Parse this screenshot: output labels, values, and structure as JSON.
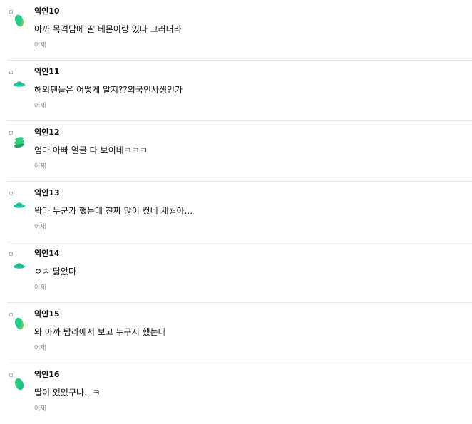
{
  "comments": [
    {
      "author": "익인10",
      "text": "아까 목격담에 딸 베몬이랑 있다 그러더라",
      "time": "어제",
      "avatar": "green-yellow-leaf-icon"
    },
    {
      "author": "익인11",
      "text": "해외팬들은 어떻게 알지??외국인사생인가",
      "time": "어제",
      "avatar": "mint-flat-icon"
    },
    {
      "author": "익인12",
      "text": "엄마 아빠 얼굴 다 보이네ㅋㅋㅋ",
      "time": "어제",
      "avatar": "green-stacked-icon"
    },
    {
      "author": "익인13",
      "text": "왐마 누군가 했는데 진짜 많이 컸네 세월아...",
      "time": "어제",
      "avatar": "mint-flat-icon"
    },
    {
      "author": "익인14",
      "text": "ㅇㅈ 닮았다",
      "time": "어제",
      "avatar": "mint-flat-icon"
    },
    {
      "author": "익인15",
      "text": "와 아까 탐라에서 보고 누구지 했는데",
      "time": "어제",
      "avatar": "green-yellow-leaf-icon"
    },
    {
      "author": "익인16",
      "text": "딸이 있었구나...ㅋ",
      "time": "어제",
      "avatar": "green-leaf-icon"
    }
  ]
}
